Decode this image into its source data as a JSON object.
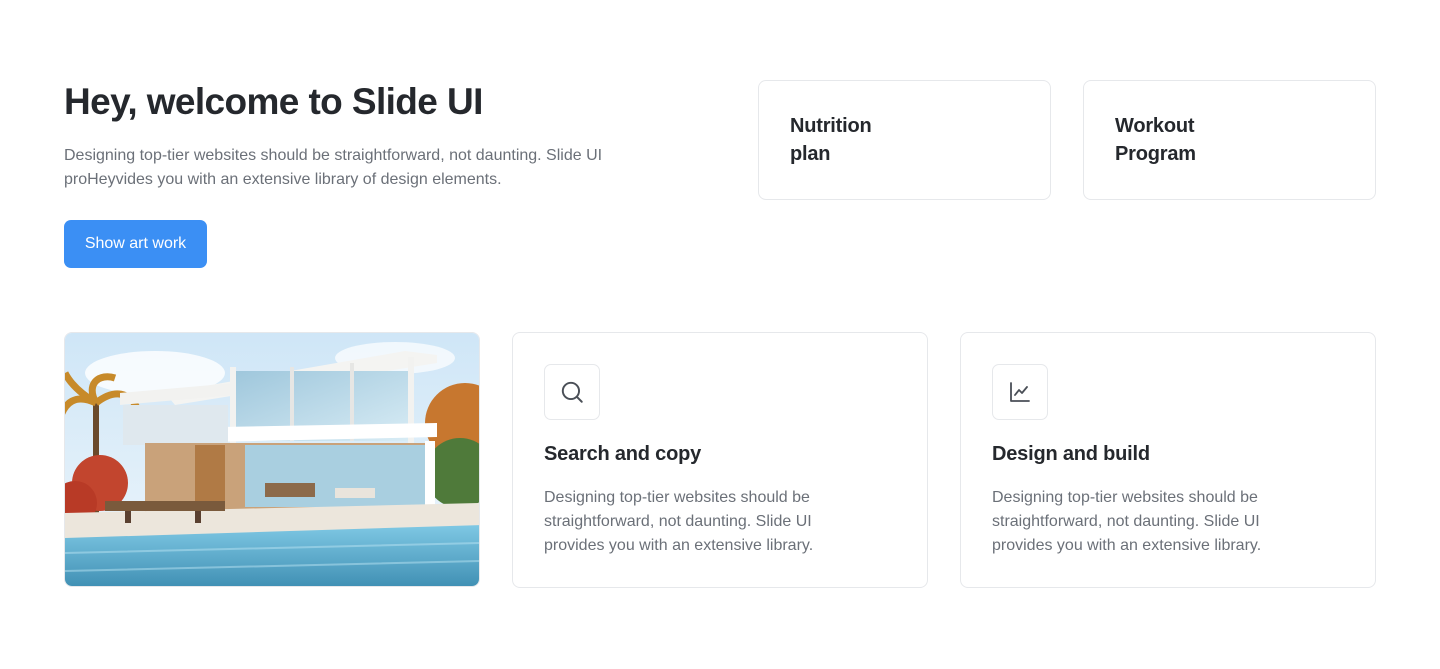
{
  "hero": {
    "title": "Hey, welcome to Slide UI",
    "description": "Designing top-tier websites should be straightforward, not daunting. Slide UI proHeyvides you with an extensive library of design elements.",
    "button_label": "Show art work"
  },
  "plans": [
    {
      "label": "Nutrition\nplan"
    },
    {
      "label": "Workout\nProgram"
    }
  ],
  "features": [
    {
      "icon": "search-icon",
      "title": "Search and copy",
      "description": "Designing top-tier websites should be straightforward, not daunting. Slide UI provides you with an extensive library."
    },
    {
      "icon": "line-chart-icon",
      "title": "Design and build",
      "description": "Designing top-tier websites should be straightforward, not daunting. Slide UI provides you with an extensive library."
    }
  ],
  "colors": {
    "accent": "#3b8ff4",
    "text_primary": "#25282d",
    "text_secondary": "#6b7078",
    "border": "#e6e8eb"
  }
}
